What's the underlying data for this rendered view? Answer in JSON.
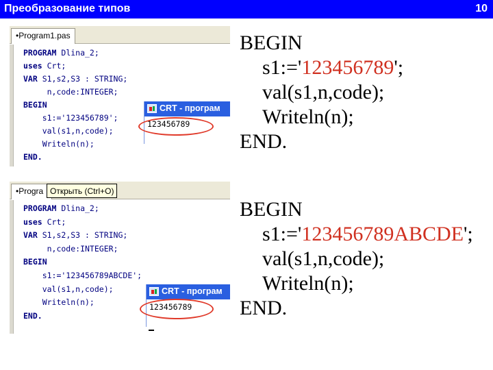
{
  "header": {
    "title": "Преобразование типов",
    "slide_number": "10"
  },
  "colors": {
    "header_bg": "#0000ff",
    "header_text": "#ffffff",
    "highlight": "#d03020",
    "ellipse": "#e03a2a",
    "crt_title_bg": "#2a5fe0"
  },
  "panel1": {
    "tab_label": "•Program1.pas",
    "code_lines": [
      {
        "kw": "PROGRAM",
        "rest": " Dlina_2;"
      },
      {
        "kw": "uses",
        "rest": " Crt;"
      },
      {
        "kw": "VAR",
        "rest": " S1,s2,S3 : STRING;"
      },
      {
        "kw": "",
        "rest": "     n,code:INTEGER;"
      },
      {
        "kw": "BEGIN",
        "rest": ""
      },
      {
        "kw": "",
        "rest": "    s1:='123456789';"
      },
      {
        "kw": "",
        "rest": "    val(s1,n,code);"
      },
      {
        "kw": "",
        "rest": "    Writeln(n);"
      },
      {
        "kw": "END.",
        "rest": ""
      }
    ],
    "crt_title": "CRT - програм",
    "crt_output": "123456789"
  },
  "panel2": {
    "tab_label": "•Progra",
    "tooltip": "Открыть (Ctrl+O)",
    "code_lines": [
      {
        "kw": "PROGRAM",
        "rest": " Dlina_2;"
      },
      {
        "kw": "uses",
        "rest": " Crt;"
      },
      {
        "kw": "VAR",
        "rest": " S1,s2,S3 : STRING;"
      },
      {
        "kw": "",
        "rest": "     n,code:INTEGER;"
      },
      {
        "kw": "BEGIN",
        "rest": ""
      },
      {
        "kw": "",
        "rest": "    s1:='123456789ABCDE';"
      },
      {
        "kw": "",
        "rest": "    val(s1,n,code);"
      },
      {
        "kw": "",
        "rest": "    Writeln(n);"
      },
      {
        "kw": "END.",
        "rest": ""
      }
    ],
    "crt_title": "CRT - програм",
    "crt_output": "123456789"
  },
  "source1": {
    "begin": "BEGIN",
    "assign_prefix": "s1:='",
    "assign_value": "123456789",
    "assign_suffix": "';",
    "val_call": "val(s1,n,code);",
    "writeln": "Writeln(n);",
    "end": "END."
  },
  "source2": {
    "begin": "BEGIN",
    "assign_prefix": "s1:='",
    "assign_value": "123456789ABCDE",
    "assign_suffix": "';",
    "val_call": "val(s1,n,code);",
    "writeln": "Writeln(n);",
    "end": "END."
  }
}
